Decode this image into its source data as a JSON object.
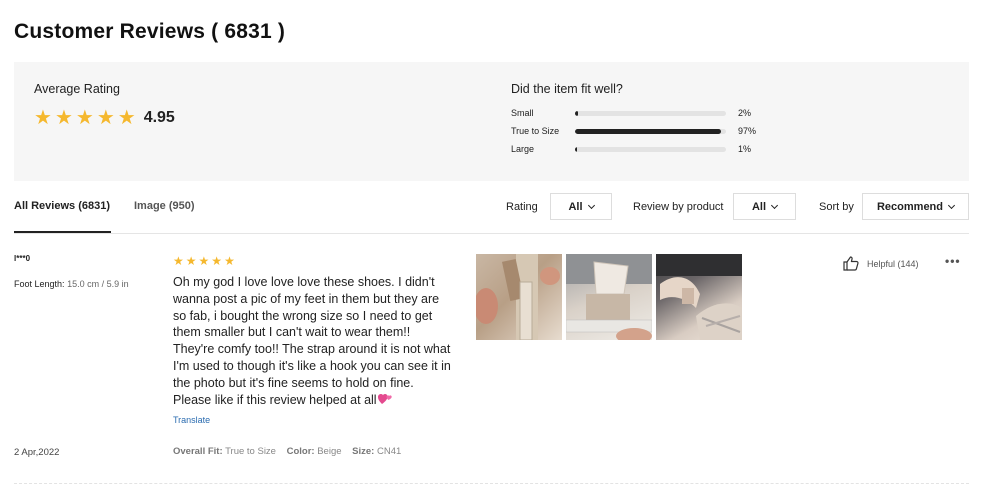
{
  "page": {
    "title": "Customer Reviews ( 6831 )"
  },
  "summary": {
    "average_label": "Average Rating",
    "average_value": "4.95",
    "star_count": 5,
    "star_color": "#f5b82e",
    "fit_title": "Did the item fit well?",
    "fit_rows": [
      {
        "label": "Small",
        "percent": "2%",
        "fraction": 0.02
      },
      {
        "label": "True to Size",
        "percent": "97%",
        "fraction": 0.97
      },
      {
        "label": "Large",
        "percent": "1%",
        "fraction": 0.01
      }
    ]
  },
  "tabs": [
    {
      "label": "All Reviews (6831)",
      "active": true
    },
    {
      "label": "Image (950)",
      "active": false
    }
  ],
  "filters": {
    "rating_label": "Rating",
    "rating_value": "All",
    "product_label": "Review by product",
    "product_value": "All",
    "sort_label": "Sort by",
    "sort_value": "Recommend"
  },
  "review": {
    "user": "l***0",
    "foot_length_label": "Foot Length:",
    "foot_length_value": "15.0 cm / 5.9 in",
    "rating": 5,
    "text": "Oh my god I love love love these shoes. I didn't wanna post a pic of my feet in them but they are so fab, i bought the wrong size so I need to get them smaller but I can't wait to wear them!! They're comfy too!! The strap around it is not what I'm used to though it's like a hook you can see it in the photo but it's fine seems to hold on fine. Please like if this review helped at all",
    "emoji": "two-hearts-icon",
    "translate_label": "Translate",
    "helpful_label": "Helpful (144)",
    "more_label": "•••",
    "date": "2 Apr,2022",
    "overall_fit_label": "Overall Fit:",
    "overall_fit_value": "True to Size",
    "color_label": "Color:",
    "color_value": "Beige",
    "size_label": "Size:",
    "size_value": "CN41",
    "photos": [
      "review-photo-1",
      "review-photo-2",
      "review-photo-3"
    ]
  }
}
